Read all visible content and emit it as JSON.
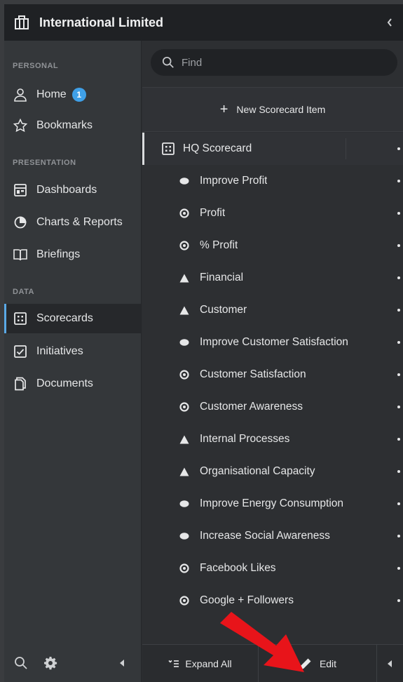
{
  "header": {
    "title": "International Limited"
  },
  "sidebar": {
    "sections": [
      {
        "label": "PERSONAL"
      },
      {
        "label": "PRESENTATION"
      },
      {
        "label": "DATA"
      }
    ],
    "items": [
      {
        "label": "Home",
        "badge": "1"
      },
      {
        "label": "Bookmarks"
      },
      {
        "label": "Dashboards"
      },
      {
        "label": "Charts & Reports"
      },
      {
        "label": "Briefings"
      },
      {
        "label": "Scorecards"
      },
      {
        "label": "Initiatives"
      },
      {
        "label": "Documents"
      }
    ]
  },
  "search": {
    "placeholder": "Find"
  },
  "new_item": {
    "label": "New Scorecard Item"
  },
  "tree": {
    "root": {
      "label": "HQ Scorecard"
    },
    "items": [
      {
        "label": "Improve Profit",
        "type": "objective"
      },
      {
        "label": "Profit",
        "type": "kpi"
      },
      {
        "label": "% Profit",
        "type": "kpi"
      },
      {
        "label": "Financial",
        "type": "perspective"
      },
      {
        "label": "Customer",
        "type": "perspective"
      },
      {
        "label": "Improve Customer Satisfaction",
        "type": "objective"
      },
      {
        "label": "Customer Satisfaction",
        "type": "kpi"
      },
      {
        "label": "Customer Awareness",
        "type": "kpi"
      },
      {
        "label": "Internal Processes",
        "type": "perspective"
      },
      {
        "label": "Organisational Capacity",
        "type": "perspective"
      },
      {
        "label": "Improve Energy Consumption",
        "type": "objective"
      },
      {
        "label": "Increase Social Awareness",
        "type": "objective"
      },
      {
        "label": "Facebook Likes",
        "type": "kpi"
      },
      {
        "label": "Google + Followers",
        "type": "kpi"
      }
    ]
  },
  "footer": {
    "expand_all": "Expand All",
    "edit": "Edit"
  },
  "colors": {
    "accent": "#3fa0e8",
    "arrow": "#e8141a"
  }
}
